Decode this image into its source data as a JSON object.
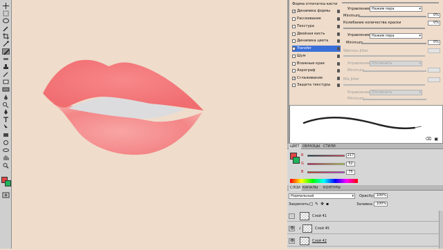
{
  "brush_panel": {
    "items": [
      {
        "label": "Форма отпечатка кисти",
        "checked": false,
        "has_checkbox": false
      },
      {
        "label": "Динамика формы",
        "checked": true,
        "has_checkbox": true
      },
      {
        "label": "Рассеивание",
        "checked": false,
        "has_checkbox": true
      },
      {
        "label": "Текстура",
        "checked": false,
        "has_checkbox": true
      },
      {
        "label": "Двойная кисть",
        "checked": false,
        "has_checkbox": true
      },
      {
        "label": "Динамика цвета",
        "checked": false,
        "has_checkbox": true
      },
      {
        "label": "Transfer",
        "checked": true,
        "has_checkbox": true,
        "selected": true
      },
      {
        "label": "Шум",
        "checked": false,
        "has_checkbox": true
      },
      {
        "label": "Влажные края",
        "checked": false,
        "has_checkbox": true
      },
      {
        "label": "Аэрограф",
        "checked": false,
        "has_checkbox": true
      },
      {
        "label": "Сглаживание",
        "checked": true,
        "has_checkbox": true
      },
      {
        "label": "Защита текстуры",
        "checked": false,
        "has_checkbox": true
      }
    ],
    "opts": {
      "control1_label": "Управление:",
      "control1_value": "Нажим пера",
      "minimum1_label": "Minimum",
      "minimum1_value": "0%",
      "jitter_label": "Колебание количества краски",
      "jitter_value": "0%",
      "control2_label": "Управление:",
      "control2_value": "Нажим пера",
      "minimum2_label": "Minimum",
      "minimum2_value": "0%",
      "wetness_label": "Wetness Jitter",
      "control3_label": "Управление:",
      "control3_value": "Отключить",
      "minimum3_label": "Minimum",
      "mix_label": "Mix Jitter",
      "control4_label": "Управление:",
      "control4_value": "Отключить",
      "minimum4_label": "Minimum"
    }
  },
  "color_panel": {
    "tabs": [
      "ЦВЕТ",
      "ОБРАЗЦЫ",
      "СТИЛИ"
    ],
    "r_label": "R",
    "r_value": "217",
    "g_label": "G",
    "g_value": "52",
    "b_label": "B",
    "b_value": "75",
    "foreground_color": "#e04545",
    "background_color": "#1fb45a"
  },
  "layers_panel": {
    "tabs": [
      "СЛОИ",
      "КАНАЛЫ",
      "КОНТУРЫ"
    ],
    "blend_mode": "Нормальный",
    "opacity_label": "Opacity:",
    "opacity_value": "100%",
    "lock_label": "Закрепить:",
    "fill_label": "Заливка:",
    "fill_value": "100%",
    "layers": [
      {
        "name": "Слой 41"
      },
      {
        "name": "Слой 45"
      },
      {
        "name": "Слой 42"
      }
    ]
  },
  "colors": {
    "canvas_bg": "#efdccb",
    "lip_color": "#f2777a",
    "selection_blue": "#3b6fd8"
  }
}
